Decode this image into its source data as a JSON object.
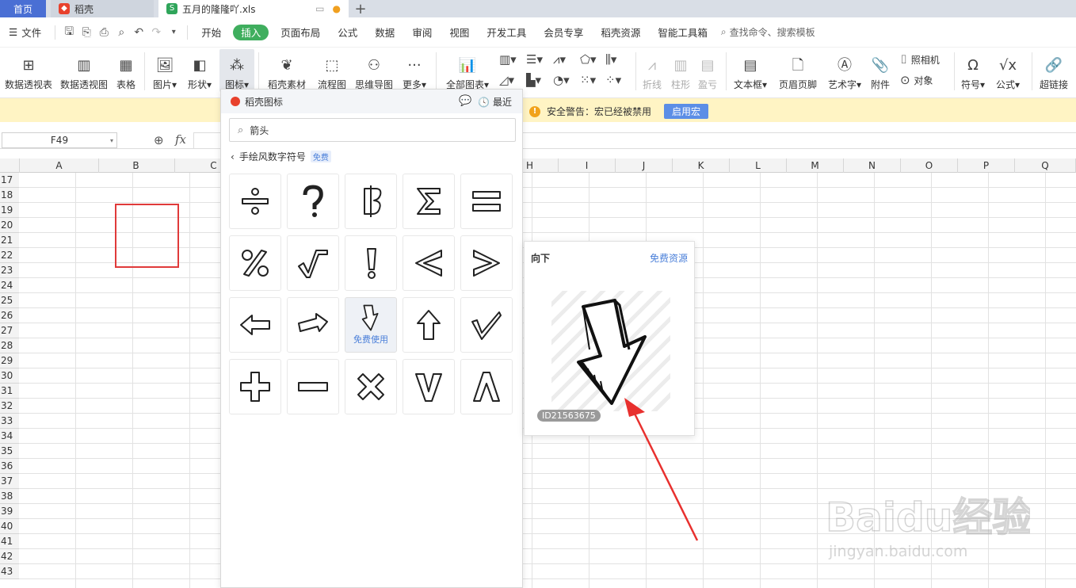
{
  "tabs": {
    "home": "首页",
    "daoke": "稻壳",
    "file": "五月的隆隆吖.xls",
    "new": "+"
  },
  "menu": {
    "file": "文件",
    "items": [
      "开始",
      "插入",
      "页面布局",
      "公式",
      "数据",
      "审阅",
      "视图",
      "开发工具",
      "会员专享",
      "稻壳资源",
      "智能工具箱"
    ],
    "active": "插入",
    "search": "查找命令、搜索模板"
  },
  "ribbon": {
    "pivot_table": "数据透视表",
    "pivot_chart": "数据透视图",
    "table": "表格",
    "picture": "图片",
    "shape": "形状",
    "icons": "图标",
    "daoke_material": "稻壳素材",
    "flowchart": "流程图",
    "mindmap": "思维导图",
    "more": "更多",
    "all_charts": "全部图表",
    "line_spark": "折线",
    "column_spark": "柱形",
    "winloss_spark": "盈亏",
    "textbox": "文本框",
    "header_footer": "页眉页脚",
    "wordart": "艺术字",
    "attachment": "附件",
    "camera": "照相机",
    "object": "对象",
    "symbol": "符号",
    "formula": "公式",
    "hyperlink": "超链接"
  },
  "warning": {
    "text": "安全警告：宏已经被禁用",
    "button": "启用宏"
  },
  "formula": {
    "cell_ref": "F49",
    "fx": "fx"
  },
  "columns": [
    "A",
    "B",
    "C",
    "H",
    "I",
    "J",
    "K",
    "L",
    "M",
    "N",
    "O",
    "P",
    "Q"
  ],
  "rows": [
    "17",
    "18",
    "19",
    "20",
    "21",
    "22",
    "23",
    "24",
    "25",
    "26",
    "27",
    "28",
    "29",
    "30",
    "31",
    "32",
    "33",
    "34",
    "35",
    "36",
    "37",
    "38",
    "39",
    "40",
    "41",
    "42",
    "43"
  ],
  "panel": {
    "title": "稻壳图标",
    "recent": "最近",
    "search_value": "箭头",
    "breadcrumb": "手绘风数字符号",
    "badge": "免费",
    "free_use": "免费使用"
  },
  "preview": {
    "title": "向下",
    "free": "免费资源",
    "id": "ID21563675"
  },
  "watermark": {
    "brand": "Baidu经验",
    "url": "jingyan.baidu.com"
  },
  "icons_glyphs": [
    "divide",
    "question",
    "baht",
    "sigma",
    "equals",
    "percent",
    "sqrt",
    "exclamation",
    "less-than",
    "greater-than",
    "arrow-left",
    "arrow-right",
    "arrow-down",
    "arrow-up",
    "check",
    "plus",
    "minus",
    "times",
    "v-letter",
    "lambda"
  ]
}
